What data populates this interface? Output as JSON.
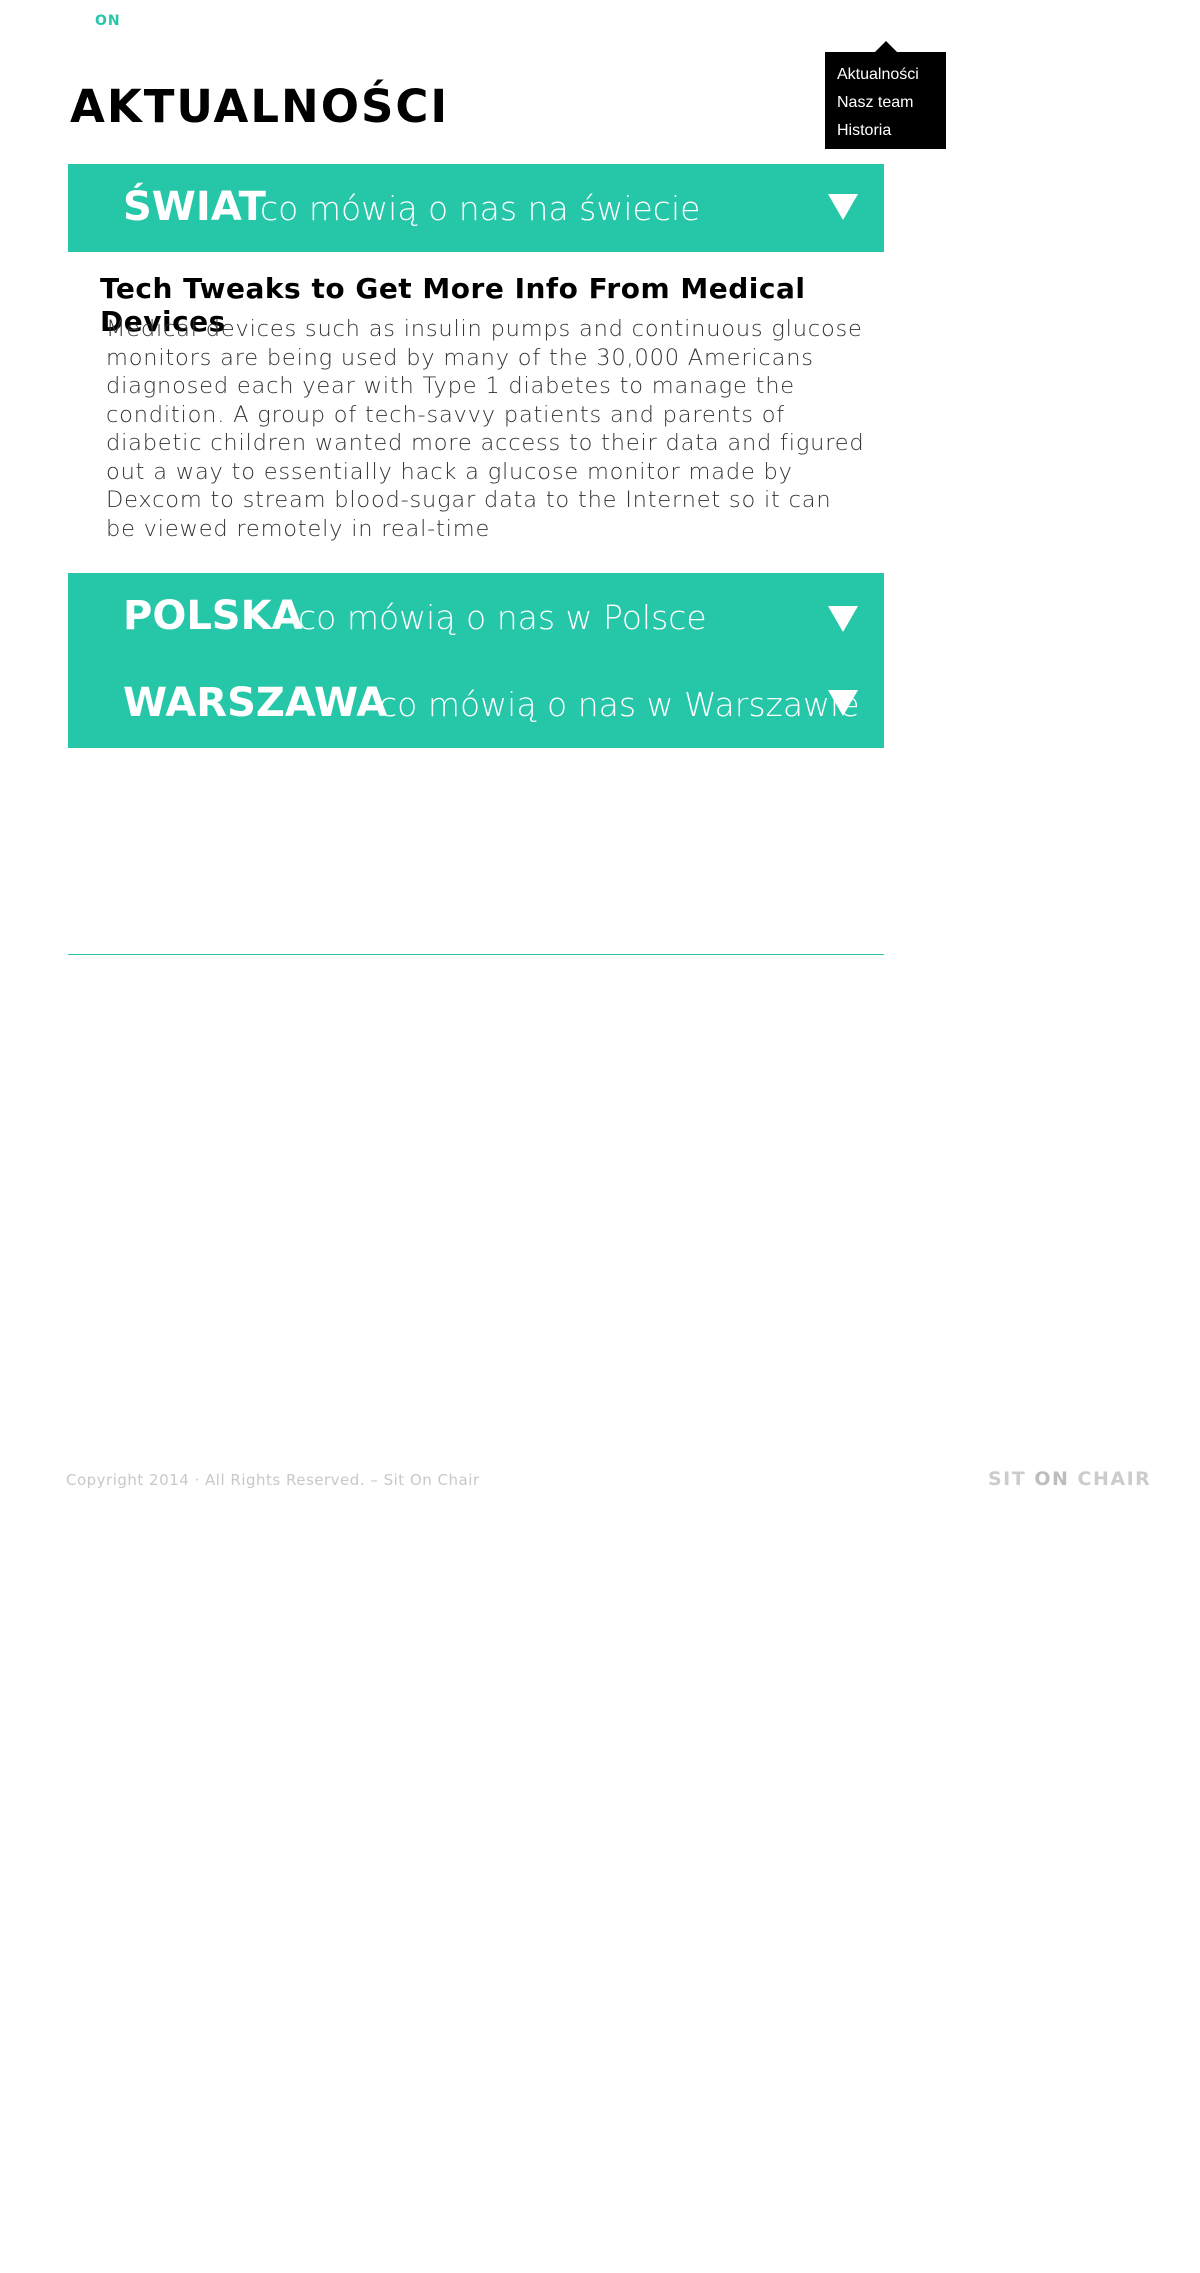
{
  "header": {
    "logo_fragment": "ON"
  },
  "page": {
    "title": "AKTUALNOŚCI"
  },
  "menu": {
    "items": [
      "Aktualności",
      "Nasz team",
      "Historia"
    ]
  },
  "sections": [
    {
      "title": "ŚWIAT",
      "subtitle": "co mówią o nas na świecie"
    },
    {
      "title": "POLSKA",
      "subtitle": "co mówią o nas w Polsce"
    },
    {
      "title": "WARSZAWA",
      "subtitle": "co mówią o nas w Warszawie"
    }
  ],
  "article": {
    "title": "Tech Tweaks to Get More Info From Medical Devices",
    "body": "Medical devices such as insulin pumps and continuous glucose monitors are being used by many of the 30,000 Americans diagnosed each year with Type 1 diabetes to manage the condition. A group of tech-savvy patients and parents of diabetic children wanted more access to their data and figured out a way to essentially hack a glucose monitor made by Dexcom to stream blood-sugar data to the Internet so it can be viewed remotely in real-time"
  },
  "footer": {
    "copyright": "Copyright 2014 · All Rights Reserved. – Sit On Chair",
    "logo_part1": "SIT ",
    "logo_part2": "ON",
    "logo_part3": " CHAIR"
  },
  "colors": {
    "accent": "#26c6a8",
    "menu_bg": "#000000",
    "footer_text": "#c8c8c8"
  },
  "icons": {
    "accordion_toggle": "triangle-down-icon"
  }
}
